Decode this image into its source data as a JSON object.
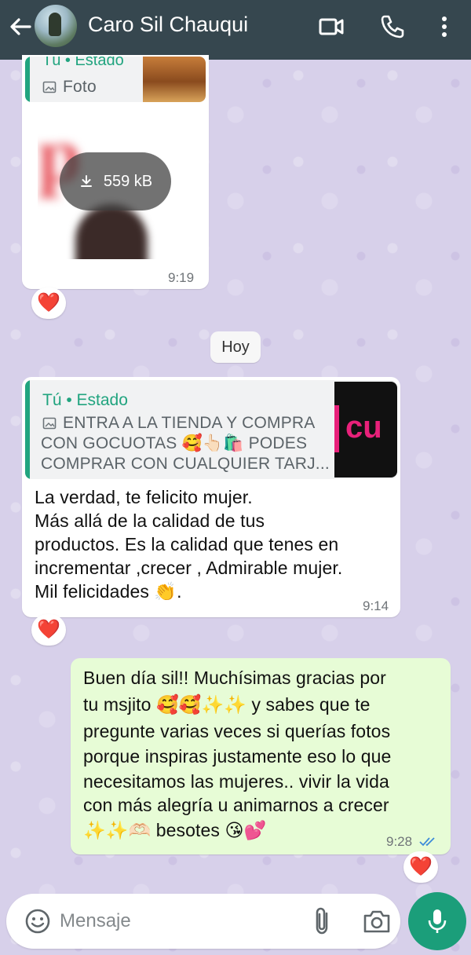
{
  "header": {
    "contact_name": "Caro Sil Chauqui",
    "icons": [
      "back-arrow-icon",
      "video-camera-icon",
      "phone-icon",
      "more-vert-icon"
    ]
  },
  "messages": [
    {
      "direction": "incoming",
      "quote": {
        "name": "Tú • Estado",
        "text": "Foto",
        "icon": "image-icon"
      },
      "media": {
        "type": "image",
        "size": "559 kB",
        "icon": "download-icon"
      },
      "time": "9:19",
      "reaction": "❤️"
    },
    {
      "direction": "incoming",
      "quote": {
        "name": "Tú • Estado",
        "lines": [
          "ENTRA A LA TIENDA Y COMPRA",
          "CON GOCUOTAS 🥰👆🏻🛍️ PODES",
          "COMPRAR CON CUALQUIER TARJ..."
        ],
        "icon": "image-icon",
        "thumb_text": "cu"
      },
      "lines": [
        "La verdad,  te felicito mujer.",
        "Más allá de la calidad de tus",
        "productos.  Es la calidad que tenes en",
        "incrementar ,crecer , Admirable mujer.",
        "Mil felicidades 👏."
      ],
      "time": "9:14",
      "reaction": "❤️"
    },
    {
      "direction": "outgoing",
      "lines": [
        "Buen día sil!! Muchísimas gracias por",
        "tu msjito 🥰🥰✨✨ y sabes que te",
        "pregunte varias veces si querías fotos",
        "porque inspiras justamente eso lo que",
        "necesitamos las mujeres.. vivir la vida",
        "con más alegría u animarnos a crecer",
        "✨✨🫶🏻 besotes 😘💕"
      ],
      "time": "9:28",
      "status": "read",
      "reaction": "❤️"
    }
  ],
  "date_chip": "Hoy",
  "composer": {
    "placeholder": "Mensaje",
    "icons": [
      "emoji-icon",
      "attach-icon",
      "camera-icon",
      "mic-icon"
    ]
  },
  "colors": {
    "header": "#36474f",
    "accent": "#21a47f",
    "outgoing_bubble": "#e7fcd6",
    "mic_button": "#1b9e7a",
    "read_ticks": "#3d8bd9",
    "reaction": "#e0243a"
  }
}
